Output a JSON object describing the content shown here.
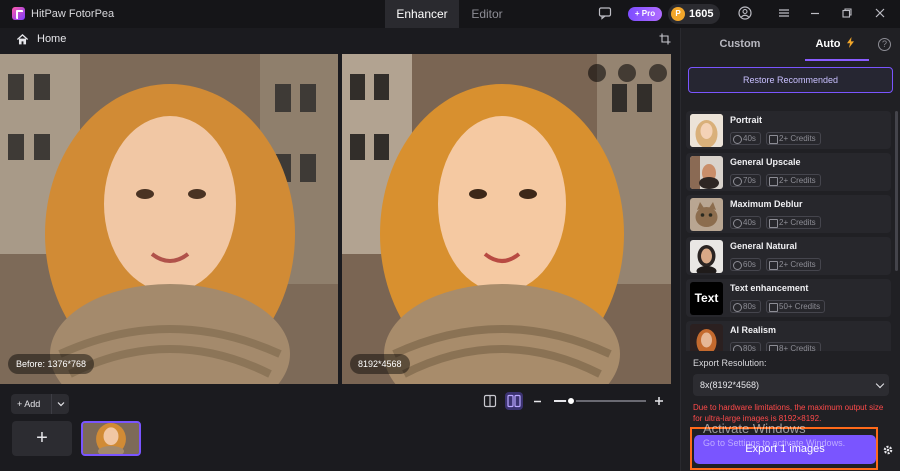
{
  "app": {
    "name": "HitPaw FotorPea"
  },
  "tabs": [
    {
      "label": "Enhancer",
      "active": true
    },
    {
      "label": "Editor",
      "active": false
    }
  ],
  "topbar": {
    "pro_label": "+ Pro",
    "credits": "1605"
  },
  "home": {
    "label": "Home"
  },
  "preview": {
    "before_label": "Before: 1376*768",
    "after_label": "8192*4568"
  },
  "toolbar": {
    "add_label": "+ Add",
    "zoom_level": 0.18
  },
  "sidebar": {
    "tabs": [
      {
        "label": "Custom"
      },
      {
        "label": "Auto"
      }
    ],
    "restore_label": "Restore Recommended",
    "models": [
      {
        "name": "Portrait",
        "time": "40s",
        "credits": "2+ Credits",
        "thumb": "portrait"
      },
      {
        "name": "General Upscale",
        "time": "70s",
        "credits": "2+ Credits",
        "thumb": "upscale"
      },
      {
        "name": "Maximum Deblur",
        "time": "40s",
        "credits": "2+ Credits",
        "thumb": "cat"
      },
      {
        "name": "General Natural",
        "time": "60s",
        "credits": "2+ Credits",
        "thumb": "natural"
      },
      {
        "name": "Text enhancement",
        "time": "80s",
        "credits": "50+ Credits",
        "thumb_text": "Text"
      },
      {
        "name": "AI Realism",
        "time": "80s",
        "credits": "8+ Credits",
        "thumb": "realism"
      }
    ],
    "export_resolution_label": "Export Resolution:",
    "resolution_value": "8x(8192*4568)",
    "warning": "Due to hardware limitations, the maximum output size for ultra-large images is 8192×8192.",
    "export_label": "Export 1 images"
  },
  "watermark": {
    "line1": "Activate Windows",
    "line2": "Go to Settings to activate Windows."
  },
  "colors": {
    "accent": "#7a55ff",
    "warning": "#ff4a4a",
    "export_outline": "#ff6a1a",
    "coin": "#f2a62a"
  }
}
